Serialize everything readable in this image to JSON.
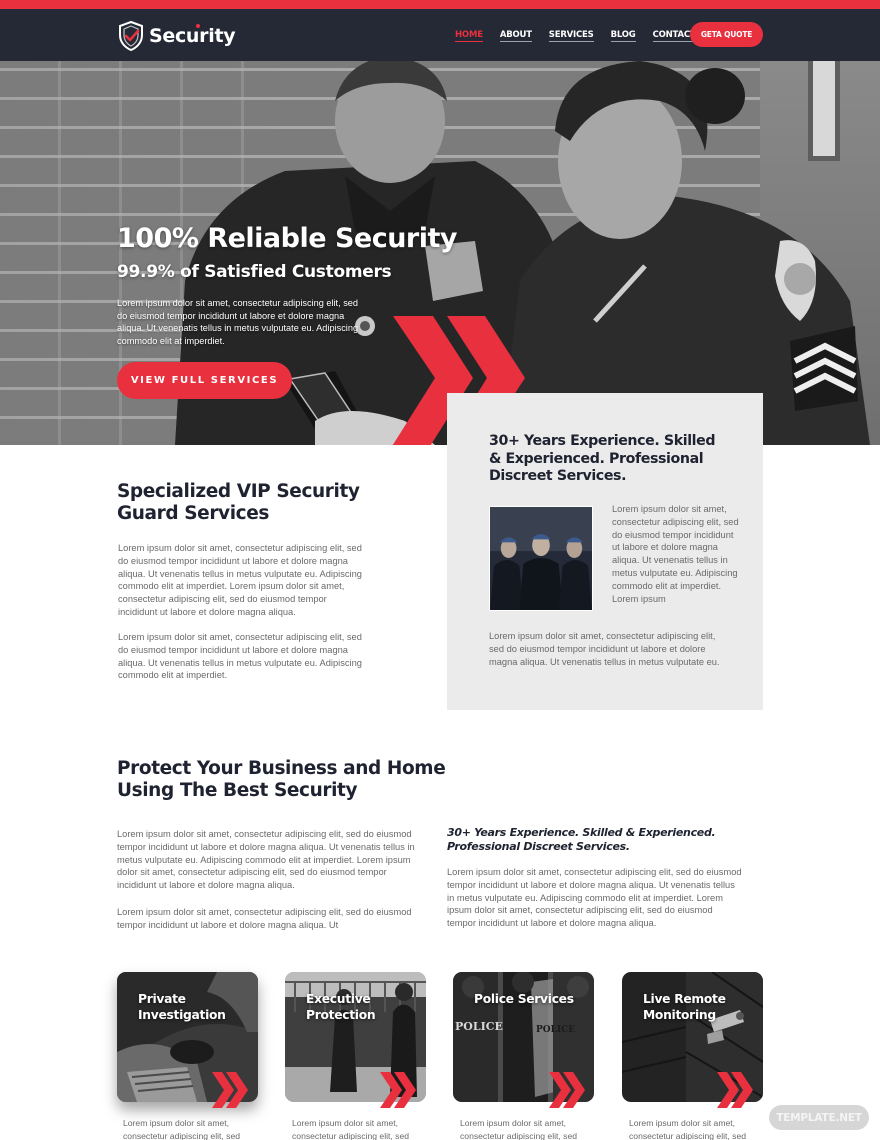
{
  "brand": {
    "name": "Security",
    "accent_color": "#e8303f",
    "nav_bg_color": "#252936",
    "dark_text_color": "#1f2230",
    "card_bg_color": "#ebebeb"
  },
  "nav": {
    "items": [
      {
        "label": "HOME",
        "active": true
      },
      {
        "label": "ABOUT",
        "active": false
      },
      {
        "label": "SERVICES",
        "active": false
      },
      {
        "label": "BLOG",
        "active": false
      },
      {
        "label": "CONTACT",
        "active": false
      }
    ],
    "cta_label": "GETA QUOTE"
  },
  "hero": {
    "title": "100% Reliable Security",
    "subtitle": "99.9% of Satisfied Customers",
    "body": "Lorem ipsum dolor sit amet, consectetur adipiscing elit, sed do eiusmod tempor incididunt ut labore et dolore magna aliqua. Ut venenatis tellus in metus vulputate eu. Adipiscing commodo elit at imperdiet.",
    "button_label": "VIEW FULL SERVICES"
  },
  "experience_card": {
    "title": "30+ Years Experience. Skilled & Experienced. Professional Discreet Services.",
    "side_text": "Lorem ipsum dolor sit amet, consectetur adipiscing elit, sed do eiusmod tempor incididunt ut labore et dolore magna aliqua. Ut venenatis tellus in metus vulputate eu. Adipiscing commodo elit at imperdiet. Lorem ipsum",
    "bottom_text": "Lorem ipsum dolor sit amet, consectetur adipiscing elit, sed do eiusmod tempor incididunt ut labore et dolore magna aliqua. Ut venenatis tellus in metus vulputate eu."
  },
  "vip_section": {
    "title": "Specialized VIP Security Guard Services",
    "paragraph1": "Lorem ipsum dolor sit amet, consectetur adipiscing elit, sed do eiusmod tempor incididunt ut labore et dolore magna aliqua. Ut venenatis tellus in metus vulputate eu. Adipiscing commodo elit at imperdiet. Lorem ipsum dolor sit amet, consectetur adipiscing elit, sed do eiusmod tempor incididunt ut labore et dolore magna aliqua.",
    "paragraph2": "Lorem ipsum dolor sit amet, consectetur adipiscing elit, sed do eiusmod tempor incididunt ut labore et dolore magna aliqua. Ut venenatis tellus in metus vulputate eu. Adipiscing commodo elit at imperdiet."
  },
  "protect_section": {
    "title": "Protect Your Business and Home Using The Best Security",
    "paragraph1": "Lorem ipsum dolor sit amet, consectetur adipiscing elit, sed do eiusmod tempor incididunt ut labore et dolore magna aliqua. Ut venenatis tellus in metus vulputate eu. Adipiscing commodo elit at imperdiet. Lorem ipsum dolor sit amet, consectetur adipiscing elit, sed do eiusmod tempor incididunt ut labore et dolore magna aliqua.",
    "paragraph2": "Lorem ipsum dolor sit amet, consectetur adipiscing elit, sed do eiusmod tempor incididunt ut labore et dolore magna aliqua. Ut",
    "side_title": "30+ Years Experience. Skilled & Experienced. Professional Discreet Services.",
    "side_paragraph": "Lorem ipsum dolor sit amet, consectetur adipiscing elit, sed do eiusmod tempor incididunt ut labore et dolore magna aliqua. Ut venenatis tellus in metus vulputate eu. Adipiscing commodo elit at imperdiet. Lorem ipsum dolor sit amet, consectetur adipiscing elit, sed do eiusmod tempor incididunt ut labore et dolore magna aliqua."
  },
  "services": [
    {
      "title": "Private Investigation",
      "text": "Lorem ipsum dolor sit amet, consectetur adipiscing elit, sed"
    },
    {
      "title": "Executive Protection",
      "text": "Lorem ipsum dolor sit amet, consectetur adipiscing elit, sed"
    },
    {
      "title": "Police Services",
      "text": "Lorem ipsum dolor sit amet, consectetur adipiscing elit, sed"
    },
    {
      "title": "Live Remote Monitoring",
      "text": "Lorem ipsum dolor sit amet, consectetur adipiscing elit, sed"
    }
  ],
  "watermark": "TEMPLATE.NET",
  "icons": {
    "logo": "shield-check-icon",
    "chevrons": "double-chevron-right-icon"
  }
}
